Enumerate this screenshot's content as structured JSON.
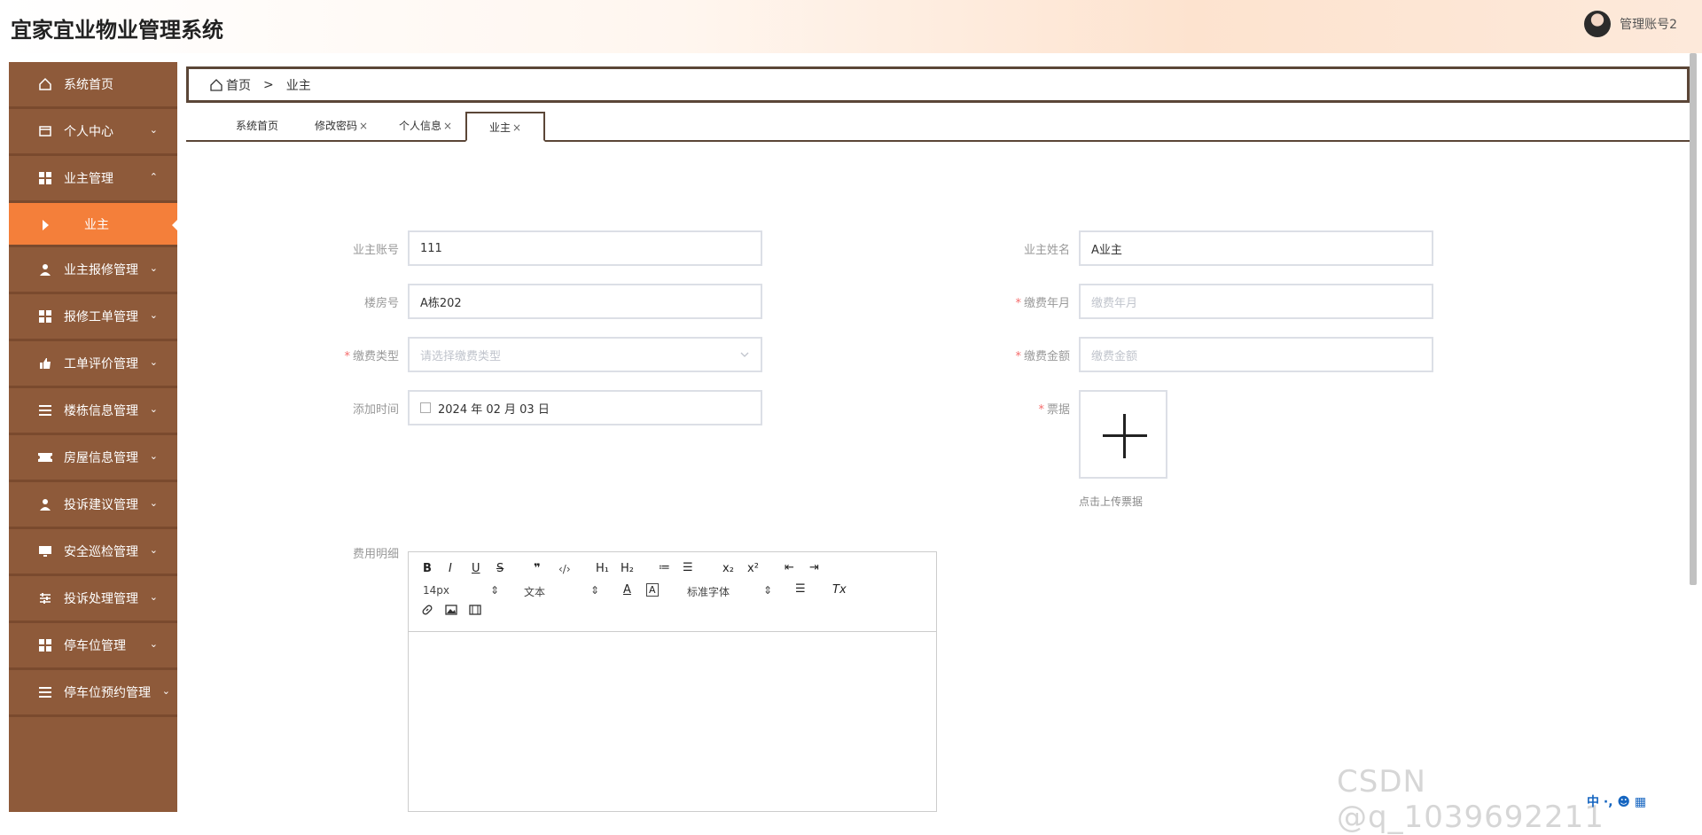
{
  "app": {
    "title": "宜家宜业物业管理系统",
    "user_name": "管理账号2"
  },
  "sidebar": {
    "items": [
      {
        "label": "系统首页",
        "icon": "home-icon"
      },
      {
        "label": "个人中心",
        "icon": "profile-icon",
        "chevron": "⌄"
      },
      {
        "label": "业主管理",
        "icon": "grid-icon",
        "chevron": "⌃"
      },
      {
        "label": "业主报修管理",
        "icon": "user-icon",
        "chevron": "⌄"
      },
      {
        "label": "报修工单管理",
        "icon": "grid-icon",
        "chevron": "⌄"
      },
      {
        "label": "工单评价管理",
        "icon": "thumb-icon",
        "chevron": "⌄"
      },
      {
        "label": "楼栋信息管理",
        "icon": "list-icon",
        "chevron": "⌄"
      },
      {
        "label": "房屋信息管理",
        "icon": "ticket-icon",
        "chevron": "⌄"
      },
      {
        "label": "投诉建议管理",
        "icon": "user-icon",
        "chevron": "⌄"
      },
      {
        "label": "安全巡检管理",
        "icon": "monitor-icon",
        "chevron": "⌄"
      },
      {
        "label": "投诉处理管理",
        "icon": "sliders-icon",
        "chevron": "⌄"
      },
      {
        "label": "停车位管理",
        "icon": "grid-icon",
        "chevron": "⌄"
      },
      {
        "label": "停车位预约管理",
        "icon": "list-icon",
        "chevron": "⌄"
      }
    ],
    "sub_item": "业主"
  },
  "breadcrumb": {
    "home": "首页",
    "separator": ">",
    "current": "业主"
  },
  "tabs": [
    {
      "label": "系统首页",
      "close": ""
    },
    {
      "label": "修改密码",
      "close": "×"
    },
    {
      "label": "个人信息",
      "close": "×"
    },
    {
      "label": "业主",
      "close": "×"
    }
  ],
  "form": {
    "owner_account": {
      "label": "业主账号",
      "value": "111"
    },
    "owner_name": {
      "label": "业主姓名",
      "value": "A业主"
    },
    "room_no": {
      "label": "楼房号",
      "value": "A栋202"
    },
    "pay_month": {
      "label": "缴费年月",
      "placeholder": "缴费年月",
      "required": "*"
    },
    "pay_type": {
      "label": "缴费类型",
      "placeholder": "请选择缴费类型",
      "required": "*"
    },
    "pay_amount": {
      "label": "缴费金额",
      "placeholder": "缴费金额",
      "required": "*"
    },
    "add_time": {
      "label": "添加时间",
      "value": "2024 年 02 月 03 日"
    },
    "receipt": {
      "label": "票据",
      "required": "*",
      "tip": "点击上传票据"
    },
    "fee_detail": {
      "label": "费用明细"
    }
  },
  "editor": {
    "toolbar_row1": [
      "B",
      "I",
      "U",
      "S",
      "❞",
      "‹/›",
      "H₁",
      "H₂",
      "≔",
      "☰",
      "x₂",
      "x²",
      "⇤",
      "⇥"
    ],
    "font_size": "14px",
    "text_style": "文本",
    "font_family": "标准字体",
    "clear_format": "Tx"
  },
  "watermark": "CSDN @q_1039692211",
  "ime": "中 ·, ☻ ▦",
  "colors": {
    "sidebar": "#8e5a3a",
    "sidebar_active": "#f47f3a",
    "border_dark": "#5b4637"
  }
}
